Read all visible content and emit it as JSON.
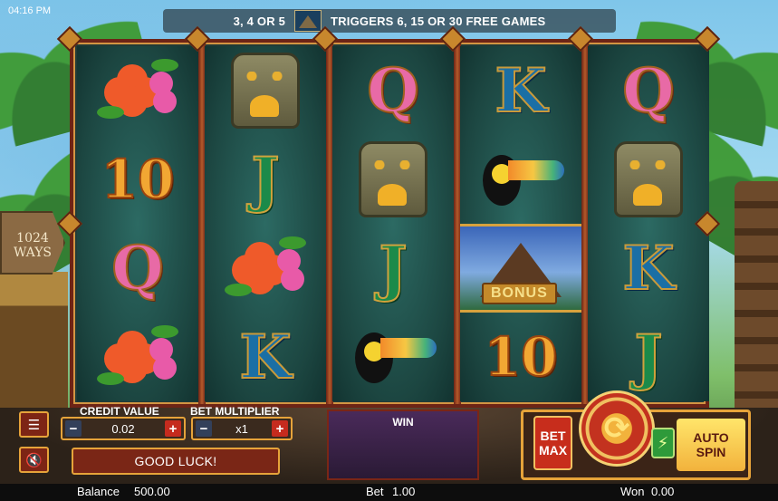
{
  "clock": "04:16 PM",
  "banner": {
    "count_text": "3, 4 OR 5",
    "trigger_text": "TRIGGERS 6, 15 OR 30 FREE GAMES",
    "icon": "pyramid-icon"
  },
  "ways_sign": {
    "line1": "1024",
    "line2": "WAYS"
  },
  "reels": [
    [
      "flower",
      "10",
      "Q",
      "flower"
    ],
    [
      "tiki",
      "J",
      "flower",
      "K"
    ],
    [
      "Q",
      "tiki",
      "J",
      "toucan"
    ],
    [
      "K",
      "toucan",
      "bonus",
      "10"
    ],
    [
      "Q",
      "tiki",
      "K",
      "J"
    ]
  ],
  "bonus_label": "BONUS",
  "panel": {
    "credit_value_label": "CREDIT VALUE",
    "credit_value": "0.02",
    "bet_multiplier_label": "BET MULTIPLIER",
    "bet_multiplier": "x1",
    "minus": "−",
    "plus": "+",
    "message": "GOOD LUCK!",
    "win_label": "WIN",
    "bet_max_line1": "BET",
    "bet_max_line2": "MAX",
    "auto_line1": "AUTO",
    "auto_line2": "SPIN"
  },
  "status": {
    "balance_label": "Balance",
    "balance": "500.00",
    "bet_label": "Bet",
    "bet": "1.00",
    "won_label": "Won",
    "won": "0.00"
  },
  "colors": {
    "frame": "#6d2416",
    "gold": "#e6a33a",
    "spin_red": "#c3321f",
    "auto_yellow": "#f2b23c"
  }
}
